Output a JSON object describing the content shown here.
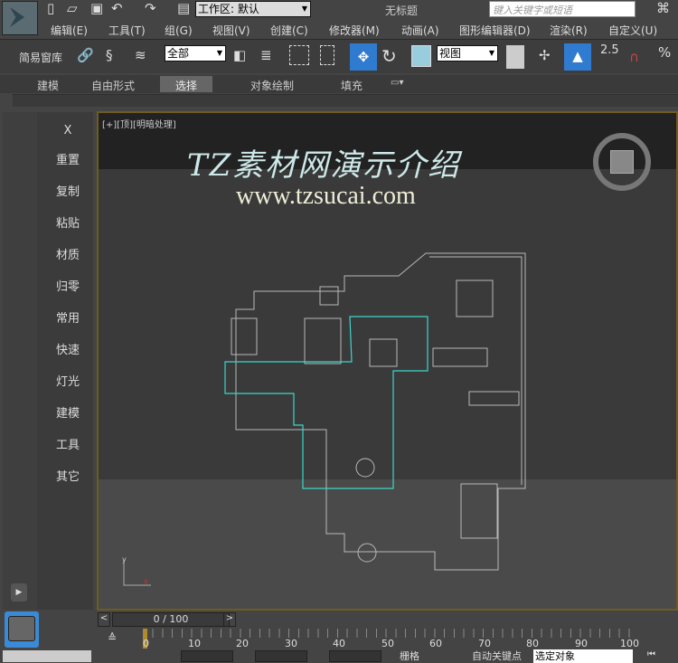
{
  "title": {
    "workspace": "工作区: 默认",
    "doc_title": "无标题",
    "search_placeholder": "键入关键字或短语"
  },
  "menu": [
    "编辑(E)",
    "工具(T)",
    "组(G)",
    "视图(V)",
    "创建(C)",
    "修改器(M)",
    "动画(A)",
    "图形编辑器(D)",
    "渲染(R)",
    "自定义(U)"
  ],
  "toolbar": {
    "label": "简易窗库",
    "filter": "全部",
    "coord": "视图",
    "snap": "2.5"
  },
  "ribbon": [
    "建模",
    "自由形式",
    "选择",
    "对象绘制",
    "填充"
  ],
  "viewport": {
    "label": "[+][顶][明暗处理]",
    "watermark1": "TZ素材网演示介绍",
    "watermark2": "www.tzsucai.com"
  },
  "commands": [
    "X",
    "重置",
    "复制",
    "粘贴",
    "材质",
    "归零",
    "常用",
    "快速",
    "灯光",
    "建模",
    "工具",
    "其它"
  ],
  "timeline": {
    "frame": "0 / 100",
    "ticks": [
      "0",
      "10",
      "20",
      "30",
      "40",
      "50",
      "60",
      "70",
      "80",
      "90",
      "100"
    ]
  },
  "status": {
    "grid": "栅格",
    "autokey": "自动关键点",
    "selected": "选定对象"
  }
}
